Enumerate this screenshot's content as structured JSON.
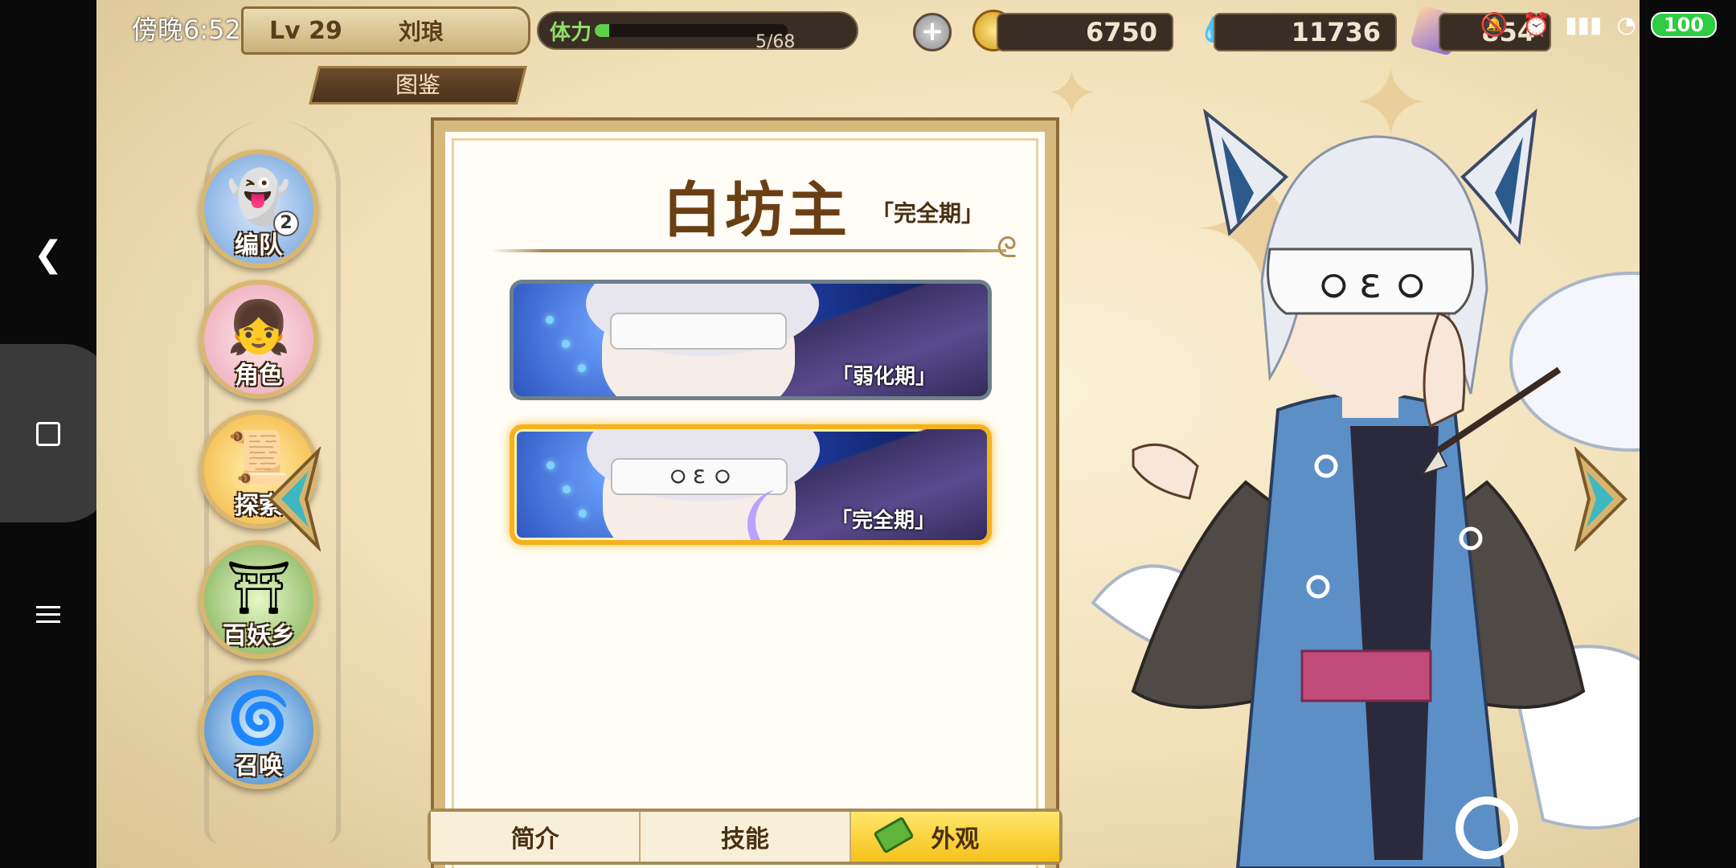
{
  "status_bar": {
    "time": "傍晚6:52",
    "battery": "100",
    "icons": [
      "mute-icon",
      "alarm-icon",
      "signal-icon",
      "wifi-icon",
      "battery-icon"
    ]
  },
  "player": {
    "level": "Lv 29",
    "name": "刘琅"
  },
  "stamina": {
    "label": "体力",
    "value": "5/68",
    "fraction": 0.074
  },
  "resources": {
    "gold": "6750",
    "blue_gem": "11736",
    "crystal": "854"
  },
  "section_title": "图鉴",
  "side_nav": [
    {
      "label": "编队",
      "icon": "team-icon"
    },
    {
      "label": "角色",
      "icon": "character-icon"
    },
    {
      "label": "探索",
      "icon": "explore-icon"
    },
    {
      "label": "百妖乡",
      "icon": "village-icon"
    },
    {
      "label": "召唤",
      "icon": "summon-icon"
    }
  ],
  "character": {
    "name": "白坊主",
    "current_phase": "「完全期」",
    "skins": [
      {
        "label": "「弱化期」",
        "selected": false
      },
      {
        "label": "「完全期」",
        "selected": true
      }
    ]
  },
  "tabs": [
    {
      "label": "简介",
      "active": false
    },
    {
      "label": "技能",
      "active": false
    },
    {
      "label": "外观",
      "active": true
    }
  ],
  "colors": {
    "gold_accent": "#f5b21d",
    "card_border": "#d7b97d",
    "title_brown": "#6b3f14"
  }
}
